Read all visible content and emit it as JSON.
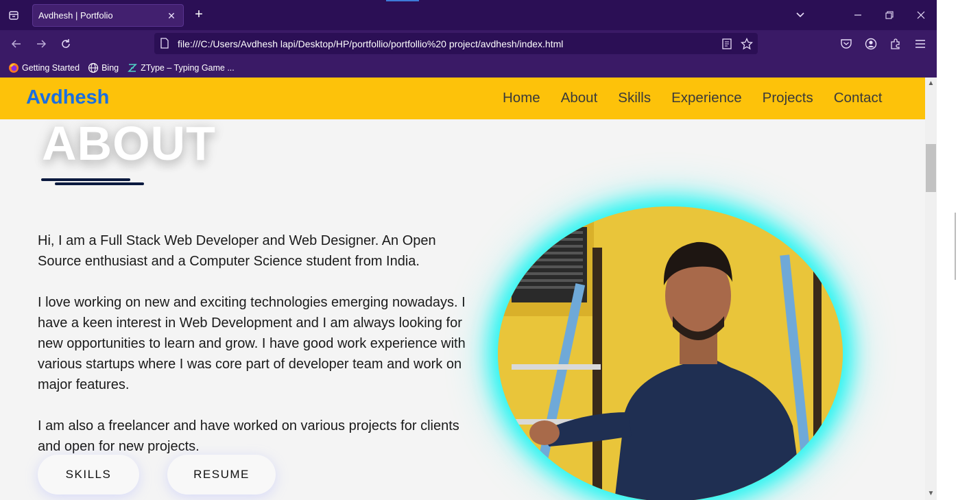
{
  "browser": {
    "tab_title": "Avdhesh | Portfolio",
    "url": "file:///C:/Users/Avdhesh lapi/Desktop/HP/portfollio/portfollio%20 project/avdhesh/index.html",
    "bookmarks": [
      {
        "label": "Getting Started",
        "icon": "firefox-icon"
      },
      {
        "label": "Bing",
        "icon": "globe-icon"
      },
      {
        "label": "ZType – Typing Game ...",
        "icon": "ztype-icon"
      }
    ]
  },
  "site": {
    "logo": "Avdhesh",
    "menu": [
      "Home",
      "About",
      "Skills",
      "Experience",
      "Projects",
      "Contact"
    ],
    "section_title": "ABOUT",
    "paragraphs": [
      "Hi, I am a Full Stack Web Developer and Web Designer. An Open Source enthusiast and a Computer Science student from India.",
      "I love working on new and exciting technologies emerging nowadays. I have a keen interest in Web Development and I am always looking for new opportunities to learn and grow. I have good work experience with various startups where I was core part of developer team and work on major features.",
      "I am also a freelancer and have worked on various projects for clients and open for new projects."
    ],
    "buttons": {
      "skills": "SKILLS",
      "resume": "RESUME"
    }
  },
  "colors": {
    "header_bg": "#fdc20a",
    "logo": "#1a6fe0",
    "glow": "#22f5f2",
    "chrome": "#3a1a66"
  }
}
